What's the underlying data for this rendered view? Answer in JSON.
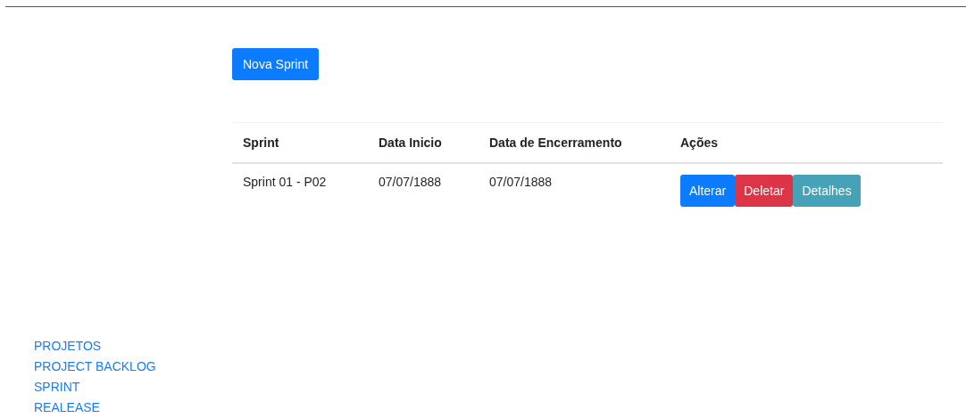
{
  "new_button": {
    "label": "Nova Sprint"
  },
  "table": {
    "columns": [
      "Sprint",
      "Data Inicio",
      "Data de Encerramento",
      "Ações"
    ],
    "rows": [
      {
        "cells": [
          "Sprint 01 - P02",
          "07/07/1888",
          "07/07/1888"
        ],
        "actions": [
          {
            "label": "Alterar",
            "kind": "primary"
          },
          {
            "label": "Deletar",
            "kind": "danger"
          },
          {
            "label": "Detalhes",
            "kind": "info"
          }
        ]
      }
    ]
  },
  "nav": {
    "items": [
      "PROJETOS",
      "PROJECT BACKLOG",
      "SPRINT",
      "REALEASE"
    ]
  }
}
